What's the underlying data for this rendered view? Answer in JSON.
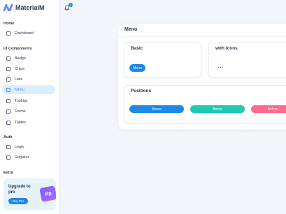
{
  "brand": {
    "name": "MaterialM"
  },
  "notifications": {
    "count": "0"
  },
  "sidebar": {
    "sections": [
      {
        "title": "Home"
      },
      {
        "title": "UI Components"
      },
      {
        "title": "Auth"
      },
      {
        "title": "Extra"
      }
    ],
    "items": [
      {
        "label": "Dashboard"
      },
      {
        "label": "Badge"
      },
      {
        "label": "Chips"
      },
      {
        "label": "Lists"
      },
      {
        "label": "Menu"
      },
      {
        "label": "Tooltips"
      },
      {
        "label": "Forms"
      },
      {
        "label": "Tables"
      },
      {
        "label": "Login"
      },
      {
        "label": "Register"
      }
    ],
    "promo": {
      "text": "Upgrade to pro",
      "button": "Buy Pro",
      "badge": "Rp"
    }
  },
  "main": {
    "title": "Menu",
    "basic": {
      "title": "Basic",
      "button": "Menu"
    },
    "icons": {
      "title": "with Icons",
      "icon": "more-dots-icon"
    },
    "positions": {
      "title": "Positions",
      "buttons": [
        {
          "label": "Above",
          "color": "#1e88e5"
        },
        {
          "label": "Below",
          "color": "#1fc8b5"
        },
        {
          "label": "Before",
          "color": "#ff6b8f"
        }
      ]
    }
  },
  "colors": {
    "accent": "#1e88e5",
    "activeBg": "#ddeeff",
    "background": "#f2f6fa"
  }
}
